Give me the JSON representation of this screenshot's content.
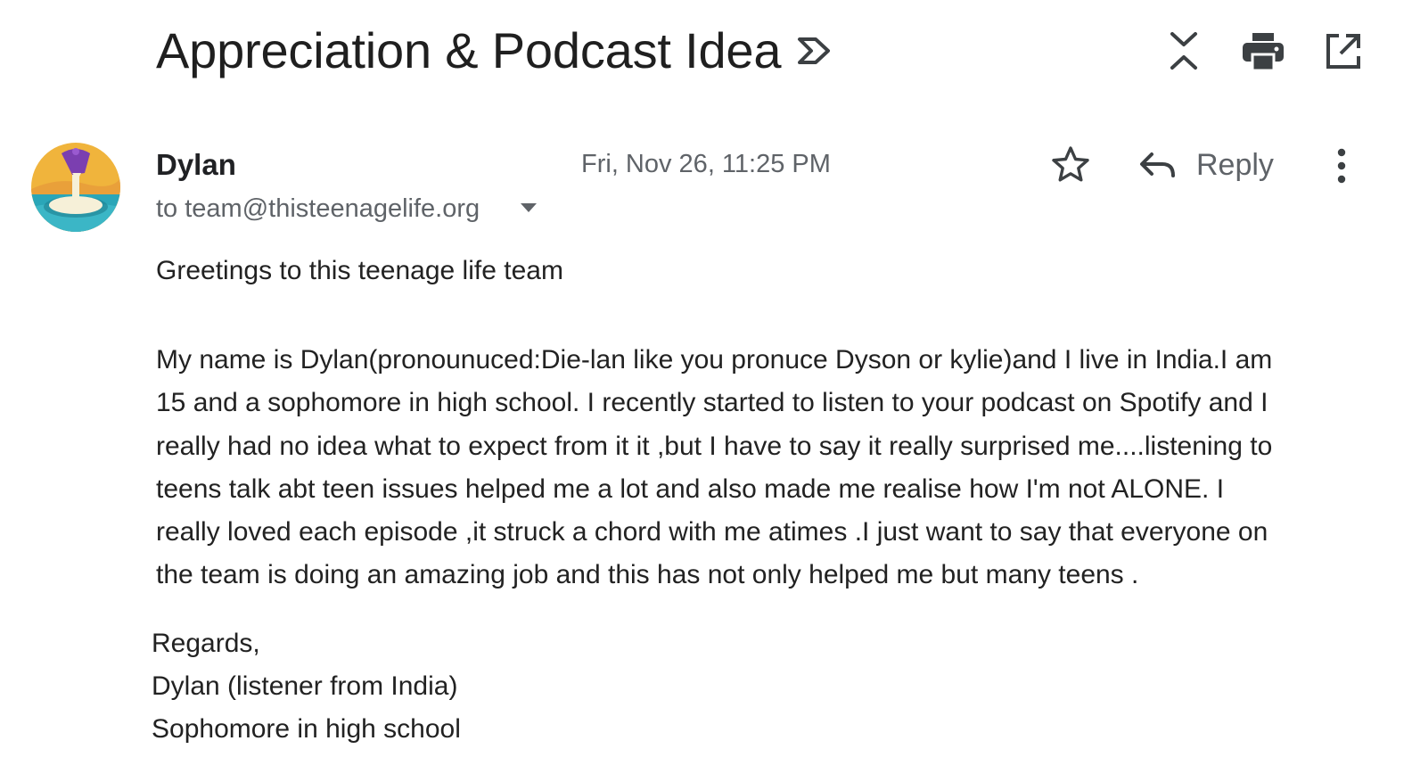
{
  "email": {
    "subject": "Appreciation & Podcast Idea",
    "sender_name": "Dylan",
    "recipient_line": "to team@thisteenagelife.org",
    "date": "Fri, Nov 26, 11:25 PM",
    "reply_label": "Reply",
    "greeting": "Greetings to this teenage life team",
    "body_lines": [
      "My name is Dylan(pronounuced:Die-lan like you pronuce Dyson or kylie)and I live in India.I am",
      "15 and a sophomore in high school. I recently started to listen to your podcast on Spotify and I",
      "really had no idea what to expect from it it ,but I have to say it really surprised me....listening to",
      "teens talk abt teen issues helped me a lot and also made me realise how I'm not ALONE. I",
      "really loved each episode ,it struck a chord with me atimes .I just want to say that everyone on",
      "the team is doing an amazing job and this has not only helped me but many teens ."
    ],
    "signature_lines": [
      "Regards,",
      "Dylan (listener from India)",
      "Sophomore in high school"
    ]
  },
  "icons": {
    "label": "label-arrow-icon",
    "collapse": "collapse-all-icon",
    "print": "print-icon",
    "new_window": "open-in-new-window-icon",
    "star": "star-outline-icon",
    "reply": "reply-arrow-icon",
    "more": "more-vertical-icon",
    "dropdown": "caret-down-icon",
    "avatar": "sender-avatar"
  },
  "colors": {
    "text_primary": "#202124",
    "text_secondary": "#5f6368",
    "icon_color": "#3c4043"
  }
}
